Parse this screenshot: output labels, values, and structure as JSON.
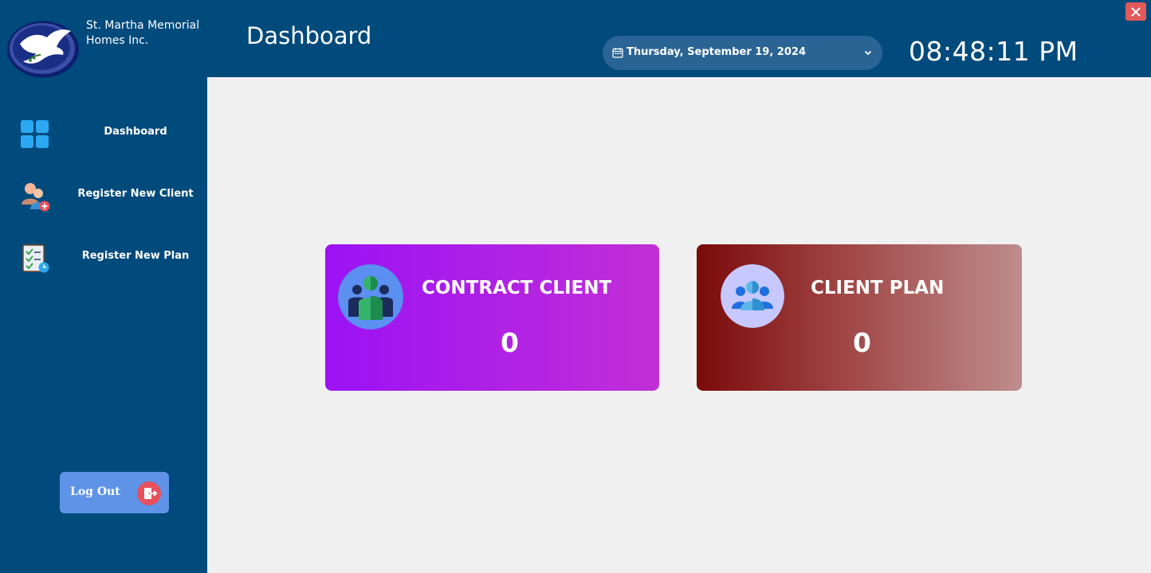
{
  "brand": {
    "company_name": "St. Martha Memorial Homes Inc."
  },
  "sidebar": {
    "items": [
      {
        "label": "Dashboard",
        "icon": "dashboard-grid-icon"
      },
      {
        "label": "Register New Client",
        "icon": "add-client-icon"
      },
      {
        "label": "Register New Plan",
        "icon": "plan-checklist-icon"
      }
    ],
    "logout_label": "Log Out"
  },
  "header": {
    "title": "Dashboard",
    "date_value": "Thursday, September 19, 2024",
    "clock": "08:48:11 PM"
  },
  "cards": {
    "contract": {
      "title": "CONTRACT CLIENT",
      "value": "0"
    },
    "plan": {
      "title": "CLIENT PLAN",
      "value": "0"
    }
  },
  "colors": {
    "sidebar_bg": "#004a7c",
    "content_bg": "#f0f0f0",
    "contract_card": [
      "#9b12f5",
      "#c22fd6"
    ],
    "plan_card": [
      "#7b0a0a",
      "#be8d8d"
    ],
    "logout_bg": "#5e93e8",
    "close_button": "#e25a5a"
  }
}
